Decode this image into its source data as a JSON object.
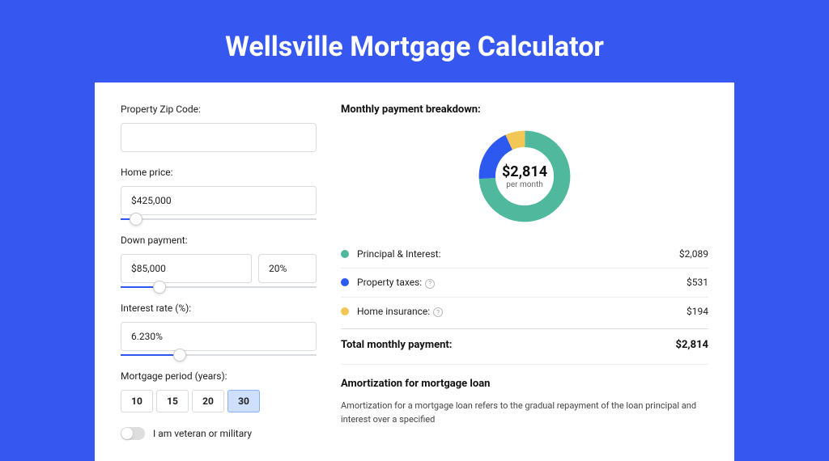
{
  "title": "Wellsville Mortgage Calculator",
  "form": {
    "zip_label": "Property Zip Code:",
    "zip_value": "",
    "home_price_label": "Home price:",
    "home_price_value": "$425,000",
    "home_price_slider_pct": 8,
    "down_payment_label": "Down payment:",
    "down_payment_value": "$85,000",
    "down_payment_pct_value": "20%",
    "down_payment_slider_pct": 20,
    "rate_label": "Interest rate (%):",
    "rate_value": "6.230%",
    "rate_slider_pct": 30,
    "period_label": "Mortgage period (years):",
    "periods": [
      "10",
      "15",
      "20",
      "30"
    ],
    "period_active_index": 3,
    "veteran_label": "I am veteran or military"
  },
  "breakdown": {
    "title": "Monthly payment breakdown:",
    "center_value": "$2,814",
    "center_sub": "per month",
    "items": [
      {
        "color": "#4fb89d",
        "label": "Principal & Interest:",
        "value": "$2,089",
        "help": false,
        "pct": 74
      },
      {
        "color": "#2d59f0",
        "label": "Property taxes:",
        "value": "$531",
        "help": true,
        "pct": 19
      },
      {
        "color": "#f3c755",
        "label": "Home insurance:",
        "value": "$194",
        "help": true,
        "pct": 7
      }
    ],
    "total_label": "Total monthly payment:",
    "total_value": "$2,814"
  },
  "amort": {
    "title": "Amortization for mortgage loan",
    "text": "Amortization for a mortgage loan refers to the gradual repayment of the loan principal and interest over a specified"
  },
  "chart_data": {
    "type": "pie",
    "title": "Monthly payment breakdown",
    "series": [
      {
        "name": "Principal & Interest",
        "value": 2089,
        "color": "#4fb89d"
      },
      {
        "name": "Property taxes",
        "value": 531,
        "color": "#2d59f0"
      },
      {
        "name": "Home insurance",
        "value": 194,
        "color": "#f3c755"
      }
    ],
    "total": 2814,
    "unit": "USD/month"
  }
}
